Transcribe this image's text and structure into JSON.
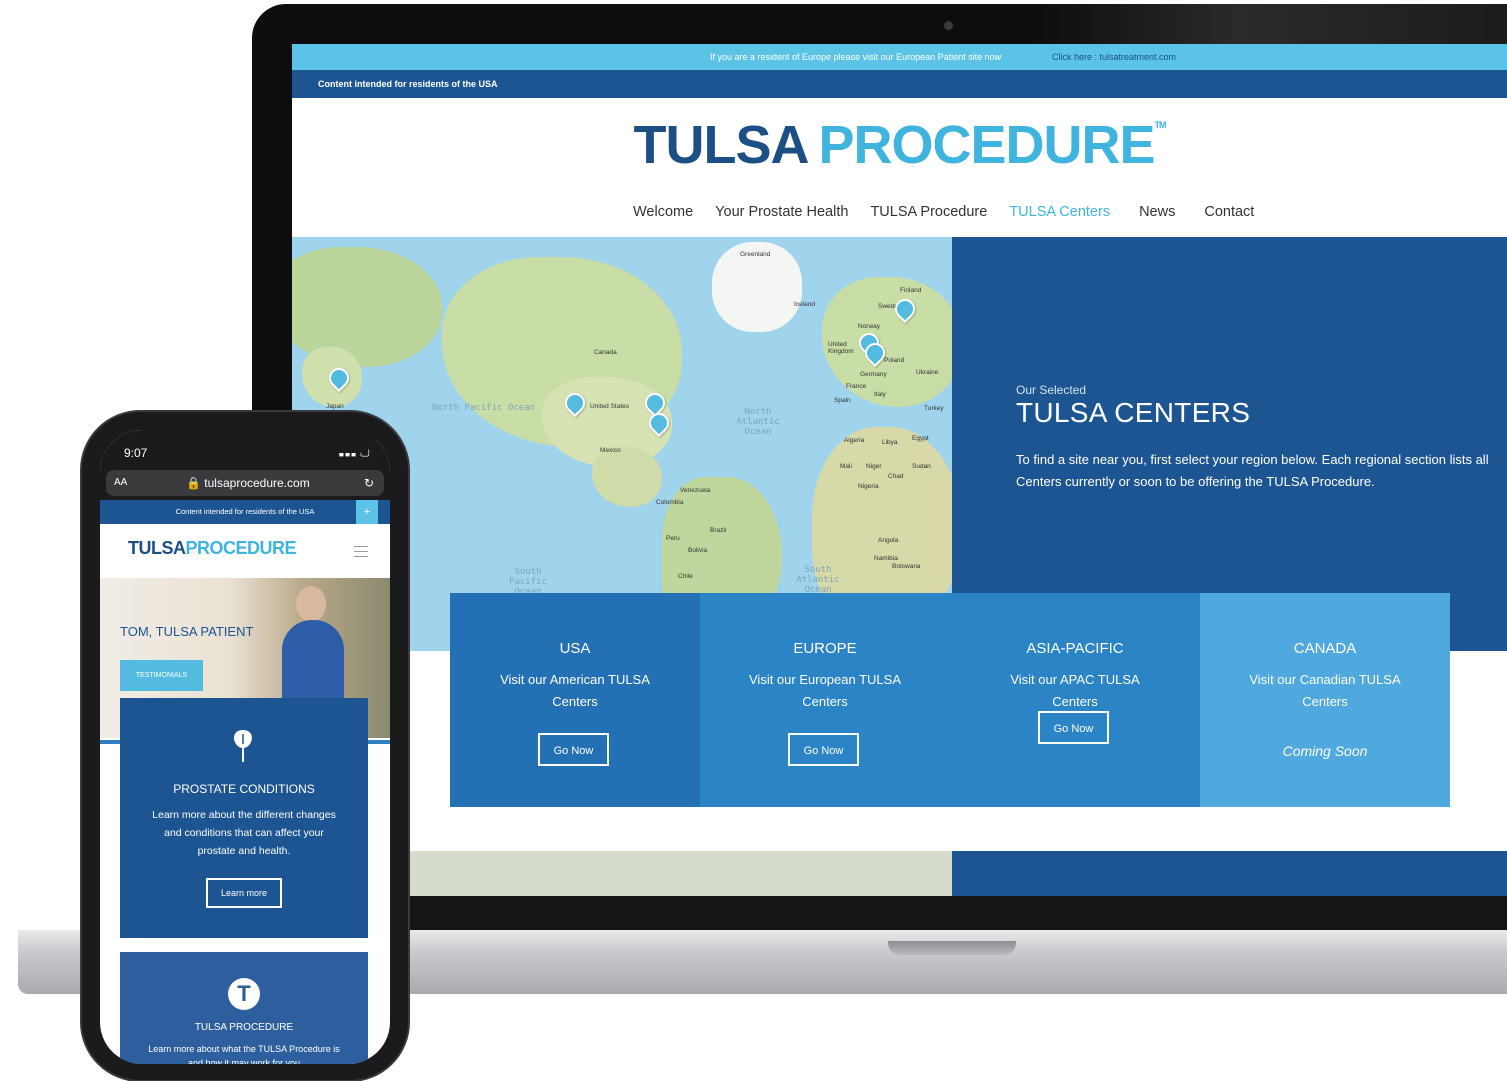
{
  "desktop": {
    "topbar": {
      "message": "If you are a resident of Europe please visit our European Patient site now",
      "link": "Click here : tulsatreatment.com"
    },
    "content_notice": "Content intended for residents of the USA",
    "logo": {
      "part1": "TULSA",
      "part2": "PROCEDURE",
      "tm": "TM"
    },
    "nav": {
      "items": [
        "Welcome",
        "Your Prostate Health",
        "TULSA Procedure",
        "TULSA Centers",
        "News",
        "Contact"
      ],
      "active": "TULSA Centers"
    },
    "map": {
      "oceans": [
        "North Pacific Ocean",
        "North Atlantic Ocean",
        "South Pacific Ocean",
        "South Atlantic Ocean"
      ],
      "places": [
        "Greenland",
        "Iceland",
        "Finland",
        "Sweden",
        "Norway",
        "United Kingdom",
        "Poland",
        "Germany",
        "Ukraine",
        "France",
        "Spain",
        "Italy",
        "Turkey",
        "Canada",
        "United States",
        "Mexico",
        "Japan",
        "Algeria",
        "Libya",
        "Egypt",
        "Mali",
        "Niger",
        "Chad",
        "Sudan",
        "Nigeria",
        "Venezuela",
        "Colombia",
        "Peru",
        "Brazil",
        "Bolivia",
        "Chile",
        "Angola",
        "Namibia",
        "Botswana"
      ],
      "pin_letter": "T"
    },
    "centers_panel": {
      "eyebrow": "Our Selected",
      "title": "TULSA CENTERS",
      "text": "To find a site near you, first select your region below. Each regional section lists all Centers currently or soon to be offering the TULSA Procedure."
    },
    "regions": [
      {
        "title": "USA",
        "desc": "Visit our American TULSA Centers",
        "button": "Go Now",
        "color": "#2470b5"
      },
      {
        "title": "EUROPE",
        "desc": "Visit our European TULSA Centers",
        "button": "Go Now",
        "color": "#2a84c6"
      },
      {
        "title": "ASIA-PACIFIC",
        "desc": "Visit our APAC TULSA Centers",
        "button": "Go Now",
        "color": "#2a84c6"
      },
      {
        "title": "CANADA",
        "desc": "Visit our Canadian TULSA Centers",
        "status": "Coming Soon",
        "color": "#4fa9df"
      }
    ]
  },
  "phone": {
    "time": "9:07",
    "url": "tulsaprocedure.com",
    "aa": "AA",
    "content_notice": "Content intended for residents of the USA",
    "plus": "+",
    "logo": {
      "part1": "TULSA",
      "part2": "PROCEDURE"
    },
    "hero_caption": "TOM, TULSA PATIENT",
    "hero_button": "TESTIMONIALS",
    "card1": {
      "title": "PROSTATE CONDITIONS",
      "desc": "Learn more about the different changes and conditions that can affect your prostate and health.",
      "button": "Learn more"
    },
    "card2": {
      "icon_letter": "T",
      "title": "TULSA PROCEDURE",
      "desc": "Learn more about what the TULSA Procedure is and how it may work for you"
    }
  },
  "colors": {
    "navy": "#1d5592",
    "cyan": "#5bc3e6",
    "logo_dark": "#1b4f86",
    "logo_light": "#3fb4df"
  }
}
